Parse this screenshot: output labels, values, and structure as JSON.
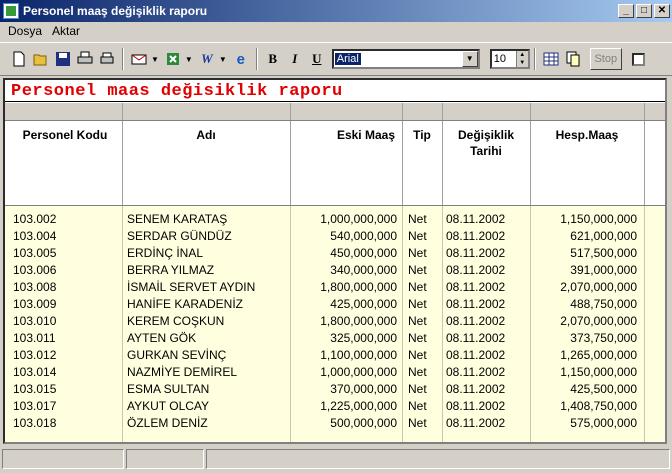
{
  "window": {
    "title": "Personel maaş değişiklik raporu"
  },
  "menu": [
    {
      "label": "Dosya"
    },
    {
      "label": "Aktar"
    }
  ],
  "toolbar": {
    "font_value": "Arial",
    "size_value": "10",
    "stop_label": "Stop",
    "bold": "B",
    "italic": "I",
    "underline": "U"
  },
  "report": {
    "title": "Personel maas değisiklik raporu",
    "headers": {
      "code": "Personel Kodu",
      "name": "Adı",
      "old": "Eski Maaş",
      "type": "Tip",
      "date_line1": "Değişiklik",
      "date_line2": "Tarihi",
      "calc": "Hesp.Maaş"
    },
    "rows": [
      {
        "code": "103.002",
        "name": "SENEM KARATAŞ",
        "old": "1,000,000,000",
        "type": "Net",
        "date": "08.11.2002",
        "calc": "1,150,000,000"
      },
      {
        "code": "103.004",
        "name": "SERDAR GÜNDÜZ",
        "old": "540,000,000",
        "type": "Net",
        "date": "08.11.2002",
        "calc": "621,000,000"
      },
      {
        "code": "103.005",
        "name": "ERDİNÇ İNAL",
        "old": "450,000,000",
        "type": "Net",
        "date": "08.11.2002",
        "calc": "517,500,000"
      },
      {
        "code": "103.006",
        "name": "BERRA YILMAZ",
        "old": "340,000,000",
        "type": "Net",
        "date": "08.11.2002",
        "calc": "391,000,000"
      },
      {
        "code": "103.008",
        "name": "İSMAİL SERVET AYDIN",
        "old": "1,800,000,000",
        "type": "Net",
        "date": "08.11.2002",
        "calc": "2,070,000,000"
      },
      {
        "code": "103.009",
        "name": "HANİFE KARADENİZ",
        "old": "425,000,000",
        "type": "Net",
        "date": "08.11.2002",
        "calc": "488,750,000"
      },
      {
        "code": "103.010",
        "name": "KEREM COŞKUN",
        "old": "1,800,000,000",
        "type": "Net",
        "date": "08.11.2002",
        "calc": "2,070,000,000"
      },
      {
        "code": "103.011",
        "name": "AYTEN GÖK",
        "old": "325,000,000",
        "type": "Net",
        "date": "08.11.2002",
        "calc": "373,750,000"
      },
      {
        "code": "103.012",
        "name": "GURKAN SEVİNÇ",
        "old": "1,100,000,000",
        "type": "Net",
        "date": "08.11.2002",
        "calc": "1,265,000,000"
      },
      {
        "code": "103.014",
        "name": "NAZMİYE DEMİREL",
        "old": "1,000,000,000",
        "type": "Net",
        "date": "08.11.2002",
        "calc": "1,150,000,000"
      },
      {
        "code": "103.015",
        "name": "ESMA SULTAN",
        "old": "370,000,000",
        "type": "Net",
        "date": "08.11.2002",
        "calc": "425,500,000"
      },
      {
        "code": "103.017",
        "name": "AYKUT OLCAY",
        "old": "1,225,000,000",
        "type": "Net",
        "date": "08.11.2002",
        "calc": "1,408,750,000"
      },
      {
        "code": "103.018",
        "name": "ÖZLEM DENİZ",
        "old": "500,000,000",
        "type": "Net",
        "date": "08.11.2002",
        "calc": "575,000,000"
      }
    ]
  },
  "colors": {
    "title_red": "#e00000",
    "row_bg": "#ffffe0",
    "titlebar": "#0a246a"
  }
}
